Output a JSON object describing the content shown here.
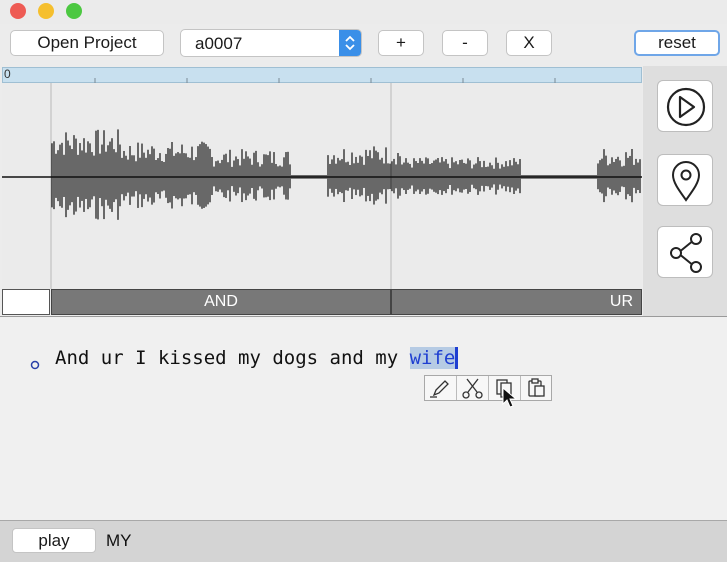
{
  "titlebar": {
    "colors": {
      "close": "#ee5b54",
      "minimize": "#f5bf2e",
      "zoom": "#4cc841"
    }
  },
  "toolbar": {
    "open_project_label": "Open Project",
    "file_select_value": "a0007",
    "add_label": "+",
    "remove_label": "-",
    "clear_label": "X",
    "reset_label": "reset"
  },
  "ruler": {
    "start_label": "0"
  },
  "segments": [
    {
      "label": ""
    },
    {
      "label": "AND"
    },
    {
      "label": "UR"
    }
  ],
  "side_buttons": [
    {
      "icon": "play-circle-icon"
    },
    {
      "icon": "location-pin-icon"
    },
    {
      "icon": "share-icon"
    }
  ],
  "transcript": {
    "text_before": "And ur I kissed my dogs and my ",
    "selected_word": "wife",
    "context_menu": [
      {
        "icon": "pencil-icon"
      },
      {
        "icon": "scissors-icon"
      },
      {
        "icon": "copy-icon"
      },
      {
        "icon": "paste-icon"
      }
    ]
  },
  "bottom": {
    "play_label": "play",
    "current_word": "MY"
  },
  "colors": {
    "segment_fill": "#787878",
    "ruler": "#c8e0ef",
    "selection": "#b6cbe4",
    "accent": "#3a8fe8"
  }
}
